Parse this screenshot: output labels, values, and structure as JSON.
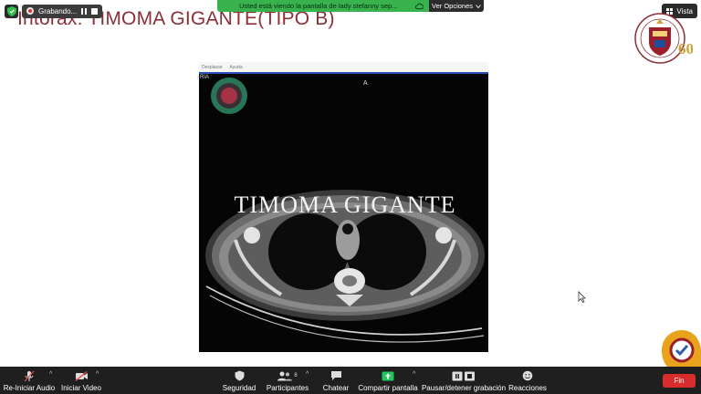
{
  "slide": {
    "title": "Intorax: TIMOMA GIGANTE(TIPO B)"
  },
  "recording": {
    "label": "Grabando..."
  },
  "share_banner": {
    "message": "Usted está viendo la pantalla de lady stefanny sep...",
    "options_label": "Ver Opciones"
  },
  "view_button": {
    "label": "Vista"
  },
  "ct_viewer": {
    "menu": [
      "Desplazar",
      "Ayuda"
    ],
    "orientation_top": "A",
    "side_label": "RIA",
    "watermark": "TIMOMA GIGANTE"
  },
  "toolbar": {
    "audio": "Re-Iniciar Audio",
    "video": "Iniciar Video",
    "security": "Seguridad",
    "participants": "Participantes",
    "participants_count": "8",
    "chat": "Chatear",
    "share": "Compartir pantalla",
    "record": "Pausar/detener grabación",
    "reactions": "Reacciones",
    "end": "Fin"
  },
  "colors": {
    "title": "#8c2f36",
    "banner": "#37b24d",
    "toolbar": "#1f1f1f",
    "end": "#d92c2c",
    "share_icon": "#22c55e"
  },
  "icons": {
    "shield": "shield-icon",
    "mic_muted": "microphone-muted-icon",
    "video_off": "video-off-icon",
    "security": "security-shield-icon",
    "participants": "participants-icon",
    "chat": "chat-bubble-icon",
    "share": "share-screen-icon",
    "record": "pause-stop-icon",
    "reactions": "emoji-icon"
  }
}
